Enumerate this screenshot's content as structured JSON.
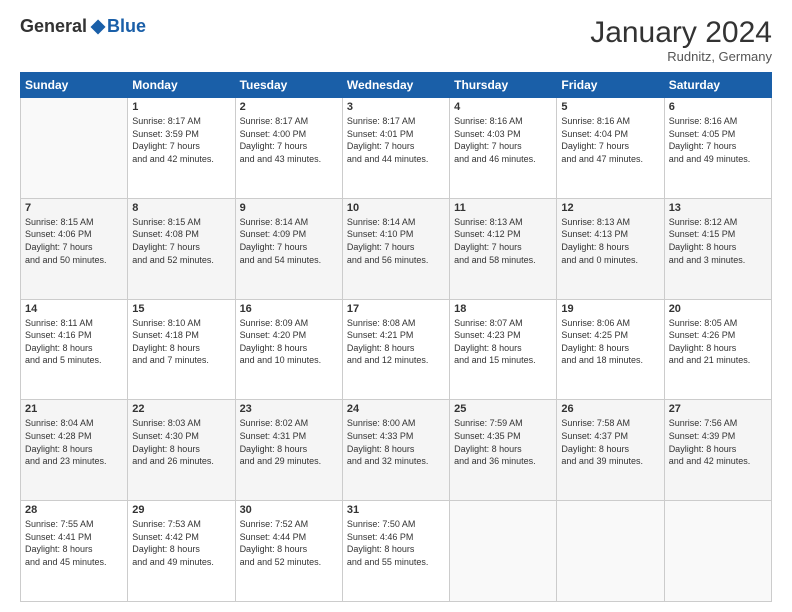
{
  "logo": {
    "general": "General",
    "blue": "Blue"
  },
  "header": {
    "month": "January 2024",
    "location": "Rudnitz, Germany"
  },
  "weekdays": [
    "Sunday",
    "Monday",
    "Tuesday",
    "Wednesday",
    "Thursday",
    "Friday",
    "Saturday"
  ],
  "weeks": [
    [
      {
        "day": "",
        "sunrise": "",
        "sunset": "",
        "daylight": ""
      },
      {
        "day": "1",
        "sunrise": "Sunrise: 8:17 AM",
        "sunset": "Sunset: 3:59 PM",
        "daylight": "Daylight: 7 hours and 42 minutes."
      },
      {
        "day": "2",
        "sunrise": "Sunrise: 8:17 AM",
        "sunset": "Sunset: 4:00 PM",
        "daylight": "Daylight: 7 hours and 43 minutes."
      },
      {
        "day": "3",
        "sunrise": "Sunrise: 8:17 AM",
        "sunset": "Sunset: 4:01 PM",
        "daylight": "Daylight: 7 hours and 44 minutes."
      },
      {
        "day": "4",
        "sunrise": "Sunrise: 8:16 AM",
        "sunset": "Sunset: 4:03 PM",
        "daylight": "Daylight: 7 hours and 46 minutes."
      },
      {
        "day": "5",
        "sunrise": "Sunrise: 8:16 AM",
        "sunset": "Sunset: 4:04 PM",
        "daylight": "Daylight: 7 hours and 47 minutes."
      },
      {
        "day": "6",
        "sunrise": "Sunrise: 8:16 AM",
        "sunset": "Sunset: 4:05 PM",
        "daylight": "Daylight: 7 hours and 49 minutes."
      }
    ],
    [
      {
        "day": "7",
        "sunrise": "Sunrise: 8:15 AM",
        "sunset": "Sunset: 4:06 PM",
        "daylight": "Daylight: 7 hours and 50 minutes."
      },
      {
        "day": "8",
        "sunrise": "Sunrise: 8:15 AM",
        "sunset": "Sunset: 4:08 PM",
        "daylight": "Daylight: 7 hours and 52 minutes."
      },
      {
        "day": "9",
        "sunrise": "Sunrise: 8:14 AM",
        "sunset": "Sunset: 4:09 PM",
        "daylight": "Daylight: 7 hours and 54 minutes."
      },
      {
        "day": "10",
        "sunrise": "Sunrise: 8:14 AM",
        "sunset": "Sunset: 4:10 PM",
        "daylight": "Daylight: 7 hours and 56 minutes."
      },
      {
        "day": "11",
        "sunrise": "Sunrise: 8:13 AM",
        "sunset": "Sunset: 4:12 PM",
        "daylight": "Daylight: 7 hours and 58 minutes."
      },
      {
        "day": "12",
        "sunrise": "Sunrise: 8:13 AM",
        "sunset": "Sunset: 4:13 PM",
        "daylight": "Daylight: 8 hours and 0 minutes."
      },
      {
        "day": "13",
        "sunrise": "Sunrise: 8:12 AM",
        "sunset": "Sunset: 4:15 PM",
        "daylight": "Daylight: 8 hours and 3 minutes."
      }
    ],
    [
      {
        "day": "14",
        "sunrise": "Sunrise: 8:11 AM",
        "sunset": "Sunset: 4:16 PM",
        "daylight": "Daylight: 8 hours and 5 minutes."
      },
      {
        "day": "15",
        "sunrise": "Sunrise: 8:10 AM",
        "sunset": "Sunset: 4:18 PM",
        "daylight": "Daylight: 8 hours and 7 minutes."
      },
      {
        "day": "16",
        "sunrise": "Sunrise: 8:09 AM",
        "sunset": "Sunset: 4:20 PM",
        "daylight": "Daylight: 8 hours and 10 minutes."
      },
      {
        "day": "17",
        "sunrise": "Sunrise: 8:08 AM",
        "sunset": "Sunset: 4:21 PM",
        "daylight": "Daylight: 8 hours and 12 minutes."
      },
      {
        "day": "18",
        "sunrise": "Sunrise: 8:07 AM",
        "sunset": "Sunset: 4:23 PM",
        "daylight": "Daylight: 8 hours and 15 minutes."
      },
      {
        "day": "19",
        "sunrise": "Sunrise: 8:06 AM",
        "sunset": "Sunset: 4:25 PM",
        "daylight": "Daylight: 8 hours and 18 minutes."
      },
      {
        "day": "20",
        "sunrise": "Sunrise: 8:05 AM",
        "sunset": "Sunset: 4:26 PM",
        "daylight": "Daylight: 8 hours and 21 minutes."
      }
    ],
    [
      {
        "day": "21",
        "sunrise": "Sunrise: 8:04 AM",
        "sunset": "Sunset: 4:28 PM",
        "daylight": "Daylight: 8 hours and 23 minutes."
      },
      {
        "day": "22",
        "sunrise": "Sunrise: 8:03 AM",
        "sunset": "Sunset: 4:30 PM",
        "daylight": "Daylight: 8 hours and 26 minutes."
      },
      {
        "day": "23",
        "sunrise": "Sunrise: 8:02 AM",
        "sunset": "Sunset: 4:31 PM",
        "daylight": "Daylight: 8 hours and 29 minutes."
      },
      {
        "day": "24",
        "sunrise": "Sunrise: 8:00 AM",
        "sunset": "Sunset: 4:33 PM",
        "daylight": "Daylight: 8 hours and 32 minutes."
      },
      {
        "day": "25",
        "sunrise": "Sunrise: 7:59 AM",
        "sunset": "Sunset: 4:35 PM",
        "daylight": "Daylight: 8 hours and 36 minutes."
      },
      {
        "day": "26",
        "sunrise": "Sunrise: 7:58 AM",
        "sunset": "Sunset: 4:37 PM",
        "daylight": "Daylight: 8 hours and 39 minutes."
      },
      {
        "day": "27",
        "sunrise": "Sunrise: 7:56 AM",
        "sunset": "Sunset: 4:39 PM",
        "daylight": "Daylight: 8 hours and 42 minutes."
      }
    ],
    [
      {
        "day": "28",
        "sunrise": "Sunrise: 7:55 AM",
        "sunset": "Sunset: 4:41 PM",
        "daylight": "Daylight: 8 hours and 45 minutes."
      },
      {
        "day": "29",
        "sunrise": "Sunrise: 7:53 AM",
        "sunset": "Sunset: 4:42 PM",
        "daylight": "Daylight: 8 hours and 49 minutes."
      },
      {
        "day": "30",
        "sunrise": "Sunrise: 7:52 AM",
        "sunset": "Sunset: 4:44 PM",
        "daylight": "Daylight: 8 hours and 52 minutes."
      },
      {
        "day": "31",
        "sunrise": "Sunrise: 7:50 AM",
        "sunset": "Sunset: 4:46 PM",
        "daylight": "Daylight: 8 hours and 55 minutes."
      },
      {
        "day": "",
        "sunrise": "",
        "sunset": "",
        "daylight": ""
      },
      {
        "day": "",
        "sunrise": "",
        "sunset": "",
        "daylight": ""
      },
      {
        "day": "",
        "sunrise": "",
        "sunset": "",
        "daylight": ""
      }
    ]
  ]
}
